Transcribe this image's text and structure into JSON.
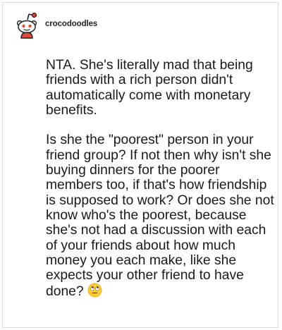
{
  "post": {
    "username": "crocodoodles",
    "avatar_icon": "reddit-snoo-avatar-icon",
    "paragraph_1": "NTA. She's literally mad that being friends with a rich person didn't automatically come with monetary benefits.",
    "paragraph_2": "Is she the \"poorest\" person in your friend group? If not then why isn't she buying dinners for the poorer members too, if that's how friendship is supposed to work? Or does she not know who's the poorest, because she's not had a discussion with each of your friends about how much money you each make, like she expects your other friend to have done?",
    "trailing_emoji": "eye-roll-emoji"
  }
}
